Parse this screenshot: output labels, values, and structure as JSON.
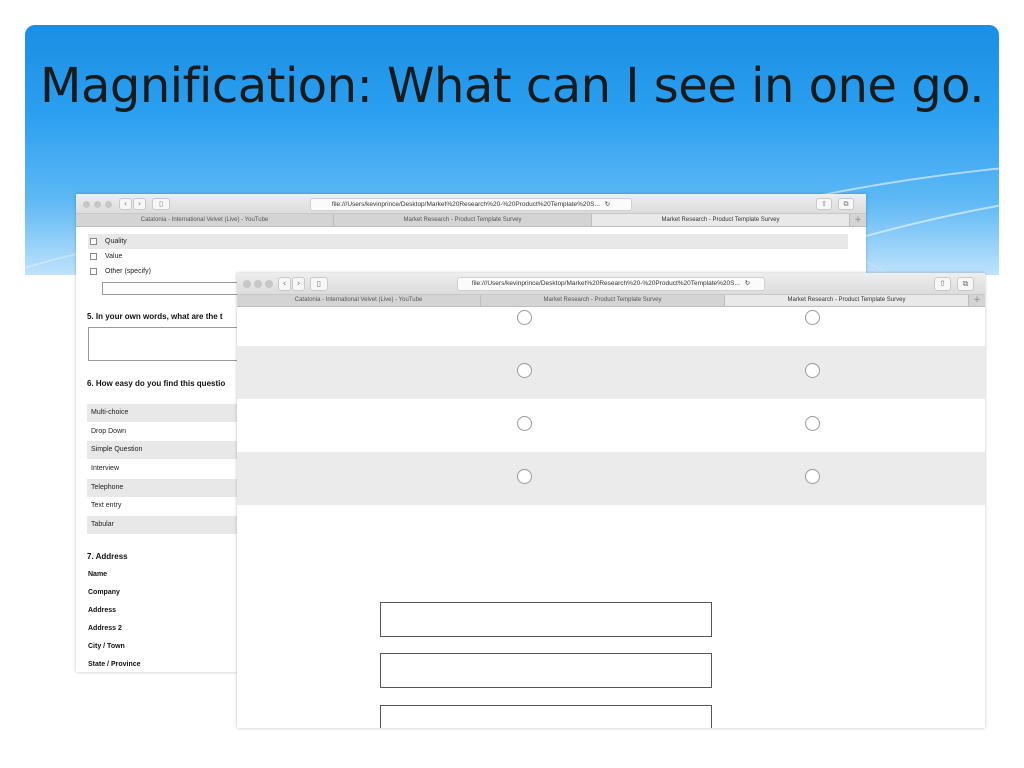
{
  "slide": {
    "title": "Magnification: What can I see in one go.",
    "accent_color": "#1a8fe3"
  },
  "back_window": {
    "url": "file:///Users/kevinprince/Desktop/Market%20Research%20-%20Product%20Template%20S...",
    "tabs": [
      {
        "label": "Catatonia - International Velvet (Live) - YouTube",
        "active": false
      },
      {
        "label": "Market Research - Product Template Survey",
        "active": false
      },
      {
        "label": "Market Research - Product Template Survey",
        "active": true
      }
    ],
    "checkbox_options": [
      {
        "label": "Quality",
        "shaded": true
      },
      {
        "label": "Value",
        "shaded": false
      },
      {
        "label": "Other (specify)",
        "shaded": false
      }
    ],
    "q5": "5. In your own words, what are the t",
    "q6": "6. How easy do you find this questio",
    "q6_options": [
      "Multi-choice",
      "Drop Down",
      "Simple Question",
      "Interview",
      "Telephone",
      "Text entry",
      "Tabular"
    ],
    "q7": "7. Address",
    "address_fields": [
      "Name",
      "Company",
      "Address",
      "Address 2",
      "City / Town",
      "State / Province"
    ]
  },
  "front_window": {
    "url": "file:///Users/kevinprince/Desktop/Market%20Research%20-%20Product%20Template%20S...",
    "tabs": [
      {
        "label": "Catatonia - International Velvet (Live) - YouTube",
        "active": false
      },
      {
        "label": "Market Research - Product Template Survey",
        "active": false
      },
      {
        "label": "Market Research - Product Template Survey",
        "active": true
      }
    ],
    "radio_rows": 4,
    "text_inputs": 3
  },
  "icons": {
    "back": "chevron-left-icon",
    "forward": "chevron-right-icon",
    "sidebar": "sidebar-icon",
    "reload": "reload-icon",
    "share": "share-icon",
    "tabs": "tabs-overview-icon",
    "new_tab": "plus-icon"
  }
}
